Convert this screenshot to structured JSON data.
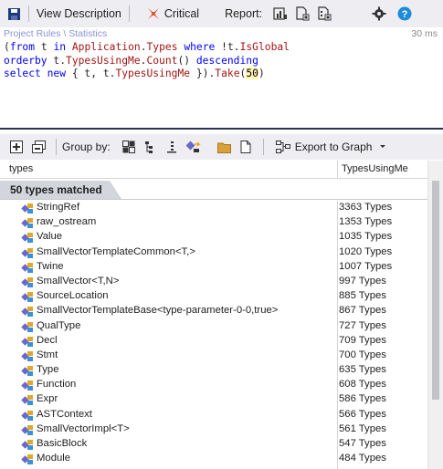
{
  "toolbar": {
    "view_description_label": "View Description",
    "critical_label": "Critical",
    "report_label": "Report:"
  },
  "editor": {
    "breadcrumb": "Project Rules \\ Statistics",
    "timing": "30 ms",
    "lines": [
      "(from t in Application.Types where !t.IsGlobal",
      "orderby t.TypesUsingMe.Count() descending",
      "select new { t, t.TypesUsingMe }).Take(50)"
    ]
  },
  "toolbar2": {
    "group_by_label": "Group by:",
    "export_label": "Export to Graph"
  },
  "grid": {
    "col_types": "types",
    "col_usage": "TypesUsingMe",
    "group_label": "50 types matched",
    "rows": [
      {
        "name": "StringRef",
        "count": "3363 Types"
      },
      {
        "name": "raw_ostream",
        "count": "1353 Types"
      },
      {
        "name": "Value",
        "count": "1035 Types"
      },
      {
        "name": "SmallVectorTemplateCommon<T,>",
        "count": "1020 Types"
      },
      {
        "name": "Twine",
        "count": "1007 Types"
      },
      {
        "name": "SmallVector<T,N>",
        "count": "997 Types"
      },
      {
        "name": "SourceLocation",
        "count": "885 Types"
      },
      {
        "name": "SmallVectorTemplateBase<type-parameter-0-0,true>",
        "count": "867 Types"
      },
      {
        "name": "QualType",
        "count": "727 Types"
      },
      {
        "name": "Decl",
        "count": "709 Types"
      },
      {
        "name": "Stmt",
        "count": "700 Types"
      },
      {
        "name": "Type",
        "count": "635 Types"
      },
      {
        "name": "Function",
        "count": "608 Types"
      },
      {
        "name": "Expr",
        "count": "586 Types"
      },
      {
        "name": "ASTContext",
        "count": "566 Types"
      },
      {
        "name": "SmallVectorImpl<T>",
        "count": "561 Types"
      },
      {
        "name": "BasicBlock",
        "count": "547 Types"
      },
      {
        "name": "Module",
        "count": "484 Types"
      },
      {
        "name": "",
        "count": ""
      }
    ]
  }
}
